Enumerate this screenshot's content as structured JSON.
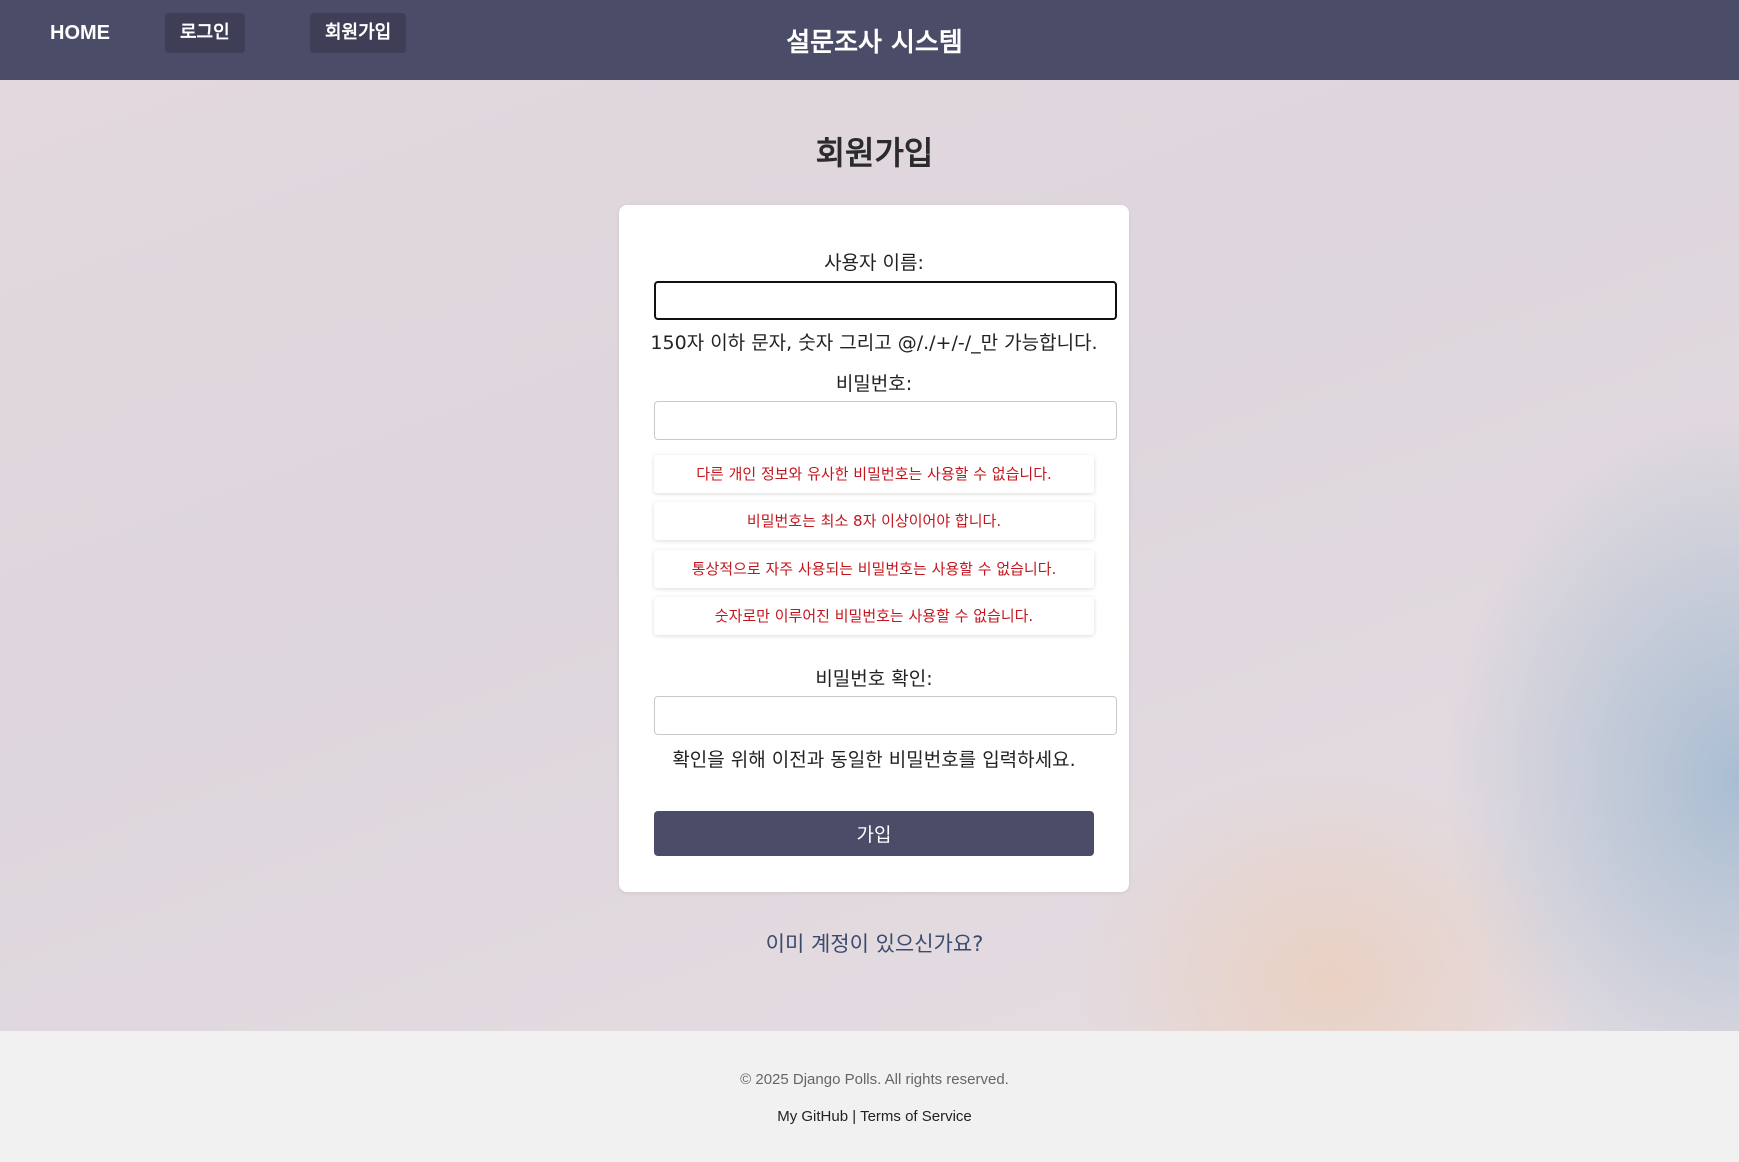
{
  "nav": {
    "home": "HOME",
    "login": "로그인",
    "signup": "회원가입",
    "site_title": "설문조사 시스템"
  },
  "page": {
    "heading": "회원가입"
  },
  "form": {
    "username_label": "사용자 이름:",
    "username_value": "",
    "username_help": "150자 이하 문자, 숫자 그리고 @/./+/-/_만 가능합니다.",
    "password_label": "비밀번호:",
    "password_value": "",
    "password_rules": [
      "다른 개인 정보와 유사한 비밀번호는 사용할 수 없습니다.",
      "비밀번호는 최소 8자 이상이어야 합니다.",
      "통상적으로 자주 사용되는 비밀번호는 사용할 수 없습니다.",
      "숫자로만 이루어진 비밀번호는 사용할 수 없습니다."
    ],
    "password_confirm_label": "비밀번호 확인:",
    "password_confirm_value": "",
    "password_confirm_help": "확인을 위해 이전과 동일한 비밀번호를 입력하세요.",
    "submit": "가입"
  },
  "login_link": "이미 계정이 있으신가요?",
  "footer": {
    "copyright": "© 2025 Django Polls. All rights reserved.",
    "github": "My GitHub",
    "separator": "|",
    "terms": "Terms of Service"
  },
  "colors": {
    "navbar": "#4b4d68",
    "button": "#4b4d68",
    "error_text": "#c3171f"
  }
}
